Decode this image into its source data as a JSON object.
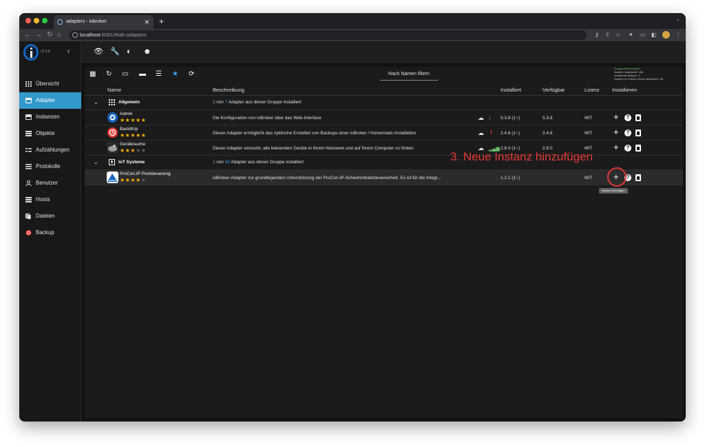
{
  "browser": {
    "tab_title": "adapters - iobroker",
    "url_host": "localhost",
    "url_rest": ":8081/#tab-adapters"
  },
  "app": {
    "version": "v5.3.8",
    "sidebar": {
      "items": [
        {
          "label": "Übersicht",
          "icon": "grid-icon"
        },
        {
          "label": "Adapter",
          "icon": "adapter-icon"
        },
        {
          "label": "Instanzen",
          "icon": "instances-icon"
        },
        {
          "label": "Objekte",
          "icon": "objects-icon"
        },
        {
          "label": "Aufzählungen",
          "icon": "enums-icon"
        },
        {
          "label": "Protokolle",
          "icon": "logs-icon"
        },
        {
          "label": "Benutzer",
          "icon": "user-icon"
        },
        {
          "label": "Hosts",
          "icon": "hosts-icon"
        },
        {
          "label": "Dateien",
          "icon": "files-icon"
        },
        {
          "label": "Backup",
          "icon": "backup-icon"
        }
      ]
    },
    "filter_placeholder": "Nach Namen filtern",
    "stats": {
      "line1": "Ausgewählte Adapter",
      "line2": "Adapter insgesamt: 486",
      "line3": "Installierte Adapter: 4",
      "line4": "Adapter im letzten Monat aktualisiert: 55"
    },
    "columns": {
      "name": "Name",
      "description": "Beschreibung",
      "installed": "Installiert",
      "available": "Verfügbar",
      "license": "Lizenz",
      "install": "Installieren"
    },
    "groups": [
      {
        "title": "Allgemein",
        "count_installed": "3",
        "count_total": "7",
        "desc_mid": " von ",
        "desc_end": " Adapter aus dieser Gruppe installiert"
      },
      {
        "title": "IoT Systeme",
        "count_installed": "1",
        "count_total": "42",
        "desc_mid": " von ",
        "desc_end": " Adapter aus dieser Gruppe installiert"
      }
    ],
    "adapters": [
      {
        "name": "Admin",
        "description": "Die Konfiguration von ioBroker über das Web-Interface",
        "installed": "5.3.8 (1~)",
        "available": "5.3.8",
        "license": "MIT",
        "rating": 4.5
      },
      {
        "name": "BackItUp",
        "description": "Dieser Adapter ermöglicht das zyklische Erstellen von Backups einer ioBroker / Homematic-Installation",
        "installed": "2.4.6 (1~)",
        "available": "2.4.6",
        "license": "MIT",
        "rating": 5
      },
      {
        "name": "Gerätesuche",
        "description": "Dieser Adapter versucht, alle bekannten Geräte in Ihrem Netzwerk und auf Ihrem Computer zu finden",
        "installed": "2.8.0 (1~)",
        "available": "2.8.0",
        "license": "MIT",
        "rating": 3
      },
      {
        "name": "ProCon.IP Poolsteuerung",
        "description": "ioBroker-Adapter zur grundlegenden Unterstützung der ProCon.IP-Schwimmbadsteuereinheit. Es ist für die Integr...",
        "installed": "1.2.1 (1~)",
        "available": "",
        "license": "MIT",
        "rating": 4
      }
    ],
    "tooltip": "Instanz hinzufügen"
  },
  "annotation": "3. Neue Instanz hinzufügen",
  "colors": {
    "accent": "#3399cc",
    "star": "#ffb300",
    "annotation": "#e53935"
  }
}
